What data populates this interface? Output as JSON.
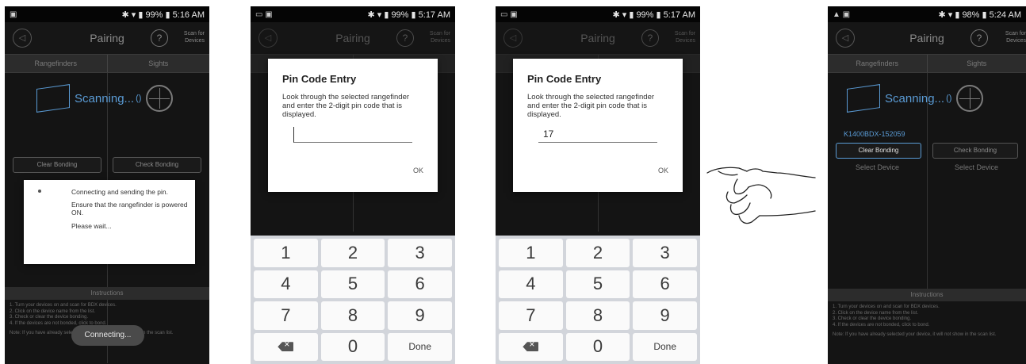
{
  "screens": [
    {
      "status_time": "5:16 AM",
      "status_battery": "99%",
      "app_title": "Pairing",
      "scan_for_devices": "Scan for Devices",
      "tabs": [
        "Rangefinders",
        "Sights"
      ],
      "scanning_text": "Scanning...",
      "buttons": [
        "Clear Bonding",
        "Check Bonding"
      ],
      "dialog": {
        "line1": "Connecting and sending the pin.",
        "line2": "Ensure that the rangefinder is powered ON.",
        "line3": "Please wait..."
      },
      "instructions_title": "Instructions",
      "instructions": [
        "1. Turn your devices on and scan for BDX devices.",
        "2. Click on the device name from the list.",
        "3. Check or clear the device bonding.",
        "4. If the devices are not bonded, click to bond."
      ],
      "instructions_note": "Note: If you have already selected your device, it will not show in the scan list.",
      "toast": "Connecting..."
    },
    {
      "status_time": "5:17 AM",
      "status_battery": "99%",
      "app_title": "Pairing",
      "scan_for_devices": "Scan for Devices",
      "tabs": [
        "Rangefinders",
        "Sights"
      ],
      "dialog": {
        "title": "Pin Code Entry",
        "body": "Look through the selected rangefinder and enter the 2-digit pin code that is displayed.",
        "input_value": "",
        "ok": "OK"
      },
      "keypad": [
        "1",
        "2",
        "3",
        "4",
        "5",
        "6",
        "7",
        "8",
        "9",
        "",
        "0",
        "Done"
      ]
    },
    {
      "status_time": "5:17 AM",
      "status_battery": "99%",
      "app_title": "Pairing",
      "scan_for_devices": "Scan for Devices",
      "tabs": [
        "Rangefinders",
        "Sights"
      ],
      "dialog": {
        "title": "Pin Code Entry",
        "body": "Look through the selected rangefinder and enter the 2-digit pin code that is displayed.",
        "input_value": "17",
        "ok": "OK"
      },
      "keypad": [
        "1",
        "2",
        "3",
        "4",
        "5",
        "6",
        "7",
        "8",
        "9",
        "",
        "0",
        "Done"
      ]
    },
    {
      "status_time": "5:24 AM",
      "status_battery": "98%",
      "app_title": "Pairing",
      "scan_for_devices": "Scan for Devices",
      "tabs": [
        "Rangefinders",
        "Sights"
      ],
      "scanning_text": "Scanning...",
      "device_name": "K1400BDX-152059",
      "buttons": [
        "Clear Bonding",
        "Check Bonding"
      ],
      "select": [
        "Select Device",
        "Select Device"
      ],
      "instructions_title": "Instructions",
      "instructions": [
        "1. Turn your devices on and scan for BDX devices.",
        "2. Click on the device name from the list.",
        "3. Check or clear the device bonding.",
        "4. If the devices are not bonded, click to bond."
      ],
      "instructions_note": "Note: If you have already selected your device, it will not show in the scan list."
    }
  ]
}
